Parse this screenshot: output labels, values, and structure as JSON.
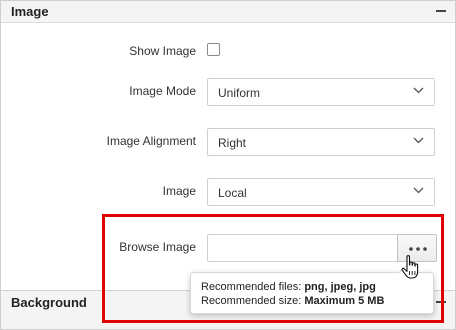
{
  "sections": {
    "image": {
      "title": "Image",
      "collapse_icon": "minus-icon"
    },
    "background": {
      "title": "Background",
      "collapse_icon": "minus-icon"
    }
  },
  "fields": {
    "show_image": {
      "label": "Show Image",
      "checked": false
    },
    "image_mode": {
      "label": "Image Mode",
      "value": "Uniform",
      "icon": "chevron-down-icon"
    },
    "image_alignment": {
      "label": "Image Alignment",
      "value": "Right",
      "icon": "chevron-down-icon"
    },
    "image_source": {
      "label": "Image",
      "value": "Local",
      "icon": "chevron-down-icon"
    },
    "browse_image": {
      "label": "Browse Image",
      "input_value": "",
      "button_icon": "ellipsis-icon"
    }
  },
  "tooltip": {
    "line1_prefix": "Recommended files: ",
    "line1_value": "png, jpeg, jpg",
    "line2_prefix": "Recommended size: ",
    "line2_value": "Maximum 5 MB"
  },
  "cursor": {
    "icon": "hand-pointer-icon"
  },
  "colors": {
    "highlight": "#e00000",
    "header_background": "#f4f4f4",
    "border": "#cfcfcf"
  }
}
